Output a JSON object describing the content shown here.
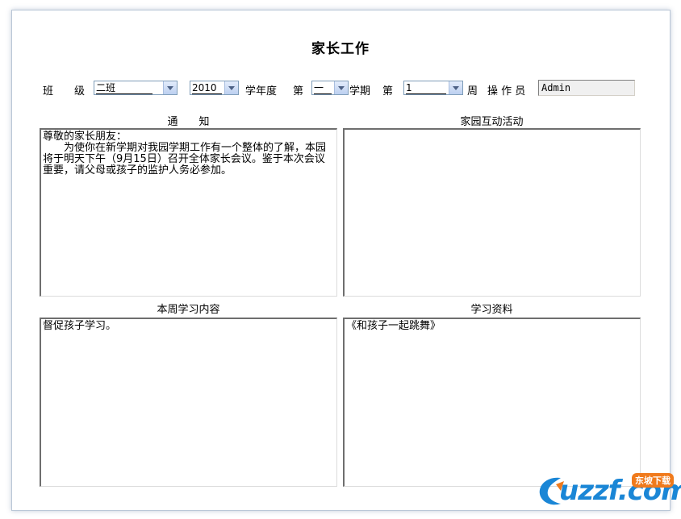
{
  "page": {
    "title": "家长工作"
  },
  "filters": {
    "class_label": "班　　级",
    "class_value": "二班",
    "year_value": "2010",
    "year_label": "学年度",
    "semester_prefix": "第",
    "semester_value": "一",
    "semester_label": "学期",
    "week_prefix": "第",
    "week_value": "1",
    "week_label": "周",
    "operator_label": "操 作 员",
    "operator_value": "Admin"
  },
  "sections": {
    "notice": {
      "title": "通　　知",
      "line1": "尊敬的家长朋友：",
      "line2": "为使你在新学期对我园学期工作有一个整体的了解，本园将于明天下午（9月15日）召开全体家长会议。鉴于本次会议重要，请父母或孩子的监护人务必参加。"
    },
    "activities": {
      "title": "家园互动活动",
      "content": ""
    },
    "study_content": {
      "title": "本周学习内容",
      "content": "督促孩子学习。"
    },
    "study_materials": {
      "title": "学习资料",
      "content": "《和孩子一起跳舞》"
    }
  },
  "watermark": {
    "brand": "uzzf.com",
    "badge": "东坡下载"
  }
}
